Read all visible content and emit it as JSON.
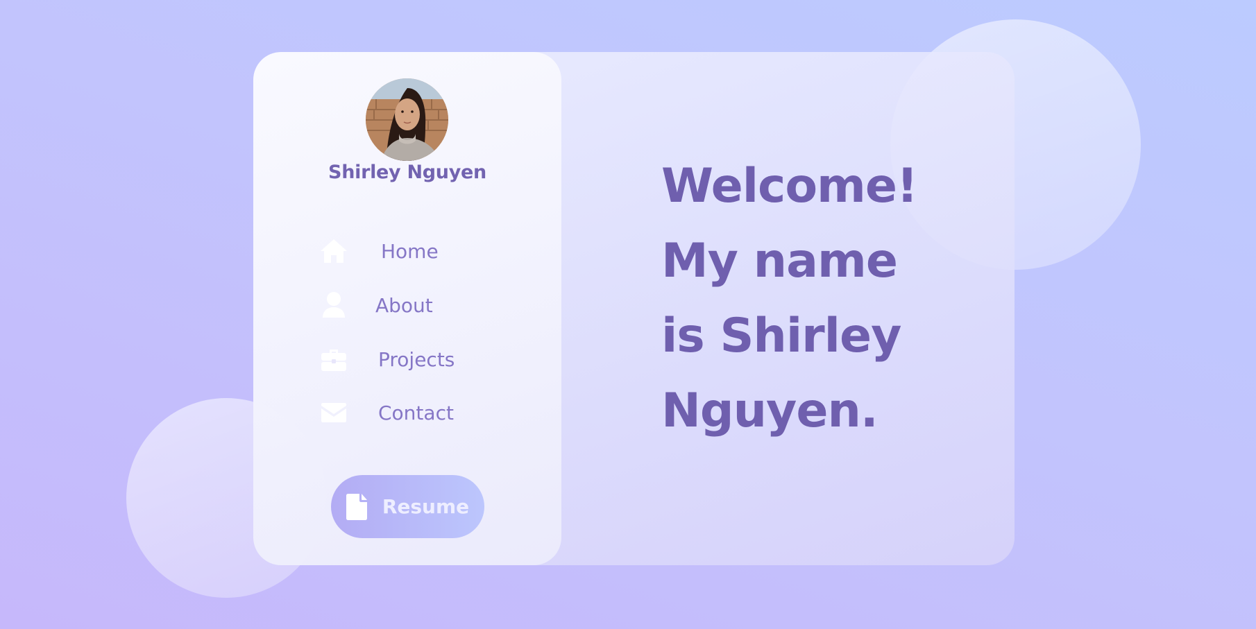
{
  "profile": {
    "name": "Shirley Nguyen",
    "avatar_icon": "profile-photo"
  },
  "nav": {
    "items": [
      {
        "label": "Home",
        "icon": "home-icon"
      },
      {
        "label": "About",
        "icon": "user-icon"
      },
      {
        "label": "Projects",
        "icon": "briefcase-icon"
      },
      {
        "label": "Contact",
        "icon": "envelope-icon"
      }
    ]
  },
  "resume": {
    "label": "Resume",
    "icon": "file-icon"
  },
  "hero": {
    "lines": [
      "Welcome!",
      "My name",
      "is Shirley",
      "Nguyen."
    ]
  },
  "colors": {
    "accent": "#6f5fae",
    "nav_text": "#8576c6",
    "button_gradient_start": "#b3acf4",
    "button_gradient_end": "#bcc6fd"
  }
}
